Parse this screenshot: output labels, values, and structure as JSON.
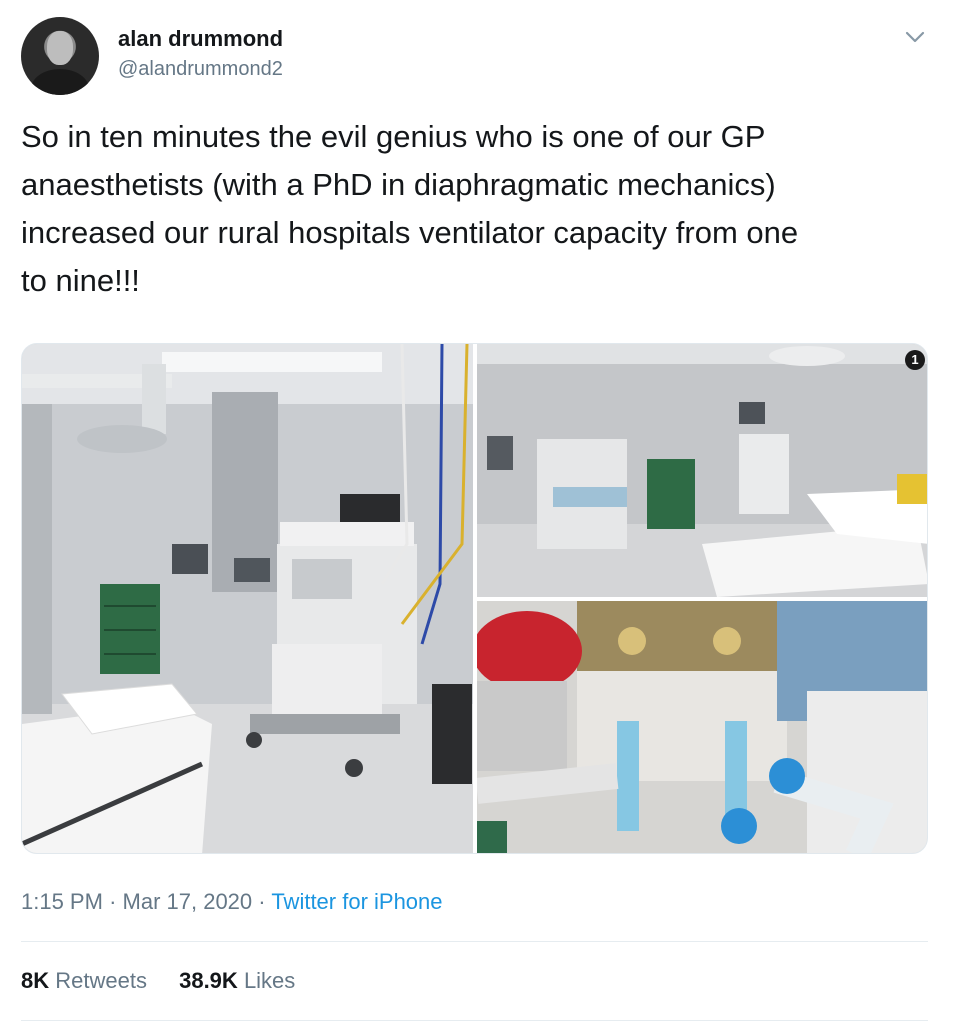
{
  "author": {
    "display_name": "alan drummond",
    "handle": "@alandrummond2"
  },
  "tweet": {
    "lines": [
      "So in ten minutes the evil genius who is one of our GP",
      "anaesthetists (with a PhD in diaphragmatic mechanics)",
      "increased our rural hospitals ventilator capacity from one",
      "to nine!!!"
    ]
  },
  "media": {
    "photo_count": 3,
    "badge": "1"
  },
  "meta": {
    "time": "1:15 PM",
    "date": "Mar 17, 2020",
    "separator": "·",
    "source": "Twitter for iPhone"
  },
  "stats": {
    "retweets_count": "8K",
    "retweets_label": "Retweets",
    "likes_count": "38.9K",
    "likes_label": "Likes"
  },
  "icons": {
    "menu": "chevron-down-icon"
  },
  "colors": {
    "link": "#1b95e0",
    "secondary_text": "#657786",
    "primary_text": "#14171a"
  }
}
